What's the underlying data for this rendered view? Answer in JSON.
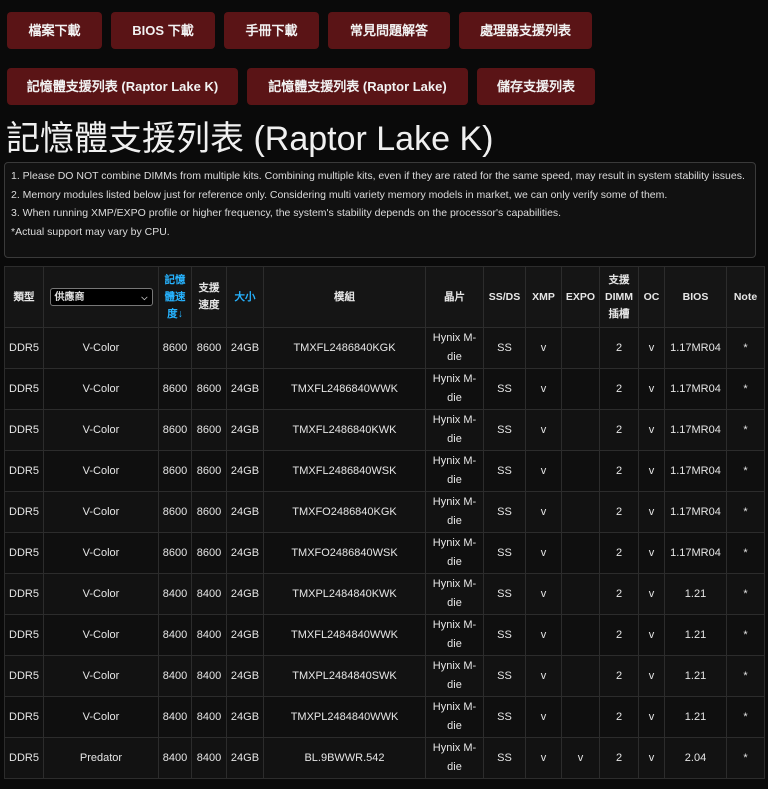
{
  "tabs": {
    "row1": [
      "檔案下載",
      "BIOS 下載",
      "手冊下載",
      "常見問題解答",
      "處理器支援列表"
    ],
    "row2": [
      "記憶體支援列表 (Raptor Lake K)",
      "記憶體支援列表 (Raptor Lake)",
      "儲存支援列表"
    ]
  },
  "page_title": "記憶體支援列表 (Raptor Lake K)",
  "notes": [
    "1. Please DO NOT combine DIMMs from multiple kits. Combining multiple kits, even if they are rated for the same speed, may result in system stability issues.",
    "2. Memory modules listed below just for reference only. Considering multi variety memory models in market, we can only verify some of them.",
    "3. When running XMP/EXPO profile or higher frequency, the system's stability depends on the processor's capabilities.",
    "*Actual support may vary by CPU."
  ],
  "table": {
    "headers": {
      "type": "類型",
      "vendor_select_value": "供應商",
      "rated_speed": "記憶體速度↓",
      "supported_speed": "支援速度",
      "size": "大小",
      "model": "模組",
      "chip": "晶片",
      "ssds": "SS/DS",
      "xmp": "XMP",
      "expo": "EXPO",
      "dimm_slots": "支援DIMM插槽",
      "oc": "OC",
      "bios": "BIOS",
      "note": "Note"
    },
    "rows": [
      [
        "DDR5",
        "V-Color",
        "8600",
        "8600",
        "24GB",
        "TMXFL2486840KGK",
        "Hynix M-die",
        "SS",
        "v",
        "",
        "2",
        "v",
        "1.17MR04",
        "*"
      ],
      [
        "DDR5",
        "V-Color",
        "8600",
        "8600",
        "24GB",
        "TMXFL2486840WWK",
        "Hynix M-die",
        "SS",
        "v",
        "",
        "2",
        "v",
        "1.17MR04",
        "*"
      ],
      [
        "DDR5",
        "V-Color",
        "8600",
        "8600",
        "24GB",
        "TMXFL2486840KWK",
        "Hynix M-die",
        "SS",
        "v",
        "",
        "2",
        "v",
        "1.17MR04",
        "*"
      ],
      [
        "DDR5",
        "V-Color",
        "8600",
        "8600",
        "24GB",
        "TMXFL2486840WSK",
        "Hynix M-die",
        "SS",
        "v",
        "",
        "2",
        "v",
        "1.17MR04",
        "*"
      ],
      [
        "DDR5",
        "V-Color",
        "8600",
        "8600",
        "24GB",
        "TMXFO2486840KGK",
        "Hynix M-die",
        "SS",
        "v",
        "",
        "2",
        "v",
        "1.17MR04",
        "*"
      ],
      [
        "DDR5",
        "V-Color",
        "8600",
        "8600",
        "24GB",
        "TMXFO2486840WSK",
        "Hynix M-die",
        "SS",
        "v",
        "",
        "2",
        "v",
        "1.17MR04",
        "*"
      ],
      [
        "DDR5",
        "V-Color",
        "8400",
        "8400",
        "24GB",
        "TMXPL2484840KWK",
        "Hynix M-die",
        "SS",
        "v",
        "",
        "2",
        "v",
        "1.21",
        "*"
      ],
      [
        "DDR5",
        "V-Color",
        "8400",
        "8400",
        "24GB",
        "TMXFL2484840WWK",
        "Hynix M-die",
        "SS",
        "v",
        "",
        "2",
        "v",
        "1.21",
        "*"
      ],
      [
        "DDR5",
        "V-Color",
        "8400",
        "8400",
        "24GB",
        "TMXPL2484840SWK",
        "Hynix M-die",
        "SS",
        "v",
        "",
        "2",
        "v",
        "1.21",
        "*"
      ],
      [
        "DDR5",
        "V-Color",
        "8400",
        "8400",
        "24GB",
        "TMXPL2484840WWK",
        "Hynix M-die",
        "SS",
        "v",
        "",
        "2",
        "v",
        "1.21",
        "*"
      ],
      [
        "DDR5",
        "Predator",
        "8400",
        "8400",
        "24GB",
        "BL.9BWWR.542",
        "Hynix M-die",
        "SS",
        "v",
        "v",
        "2",
        "v",
        "2.04",
        "*"
      ]
    ]
  },
  "colors": {
    "background": "#0a0a0a",
    "tab_bg": "#5a1416",
    "accent_header": "#26b3ff"
  }
}
